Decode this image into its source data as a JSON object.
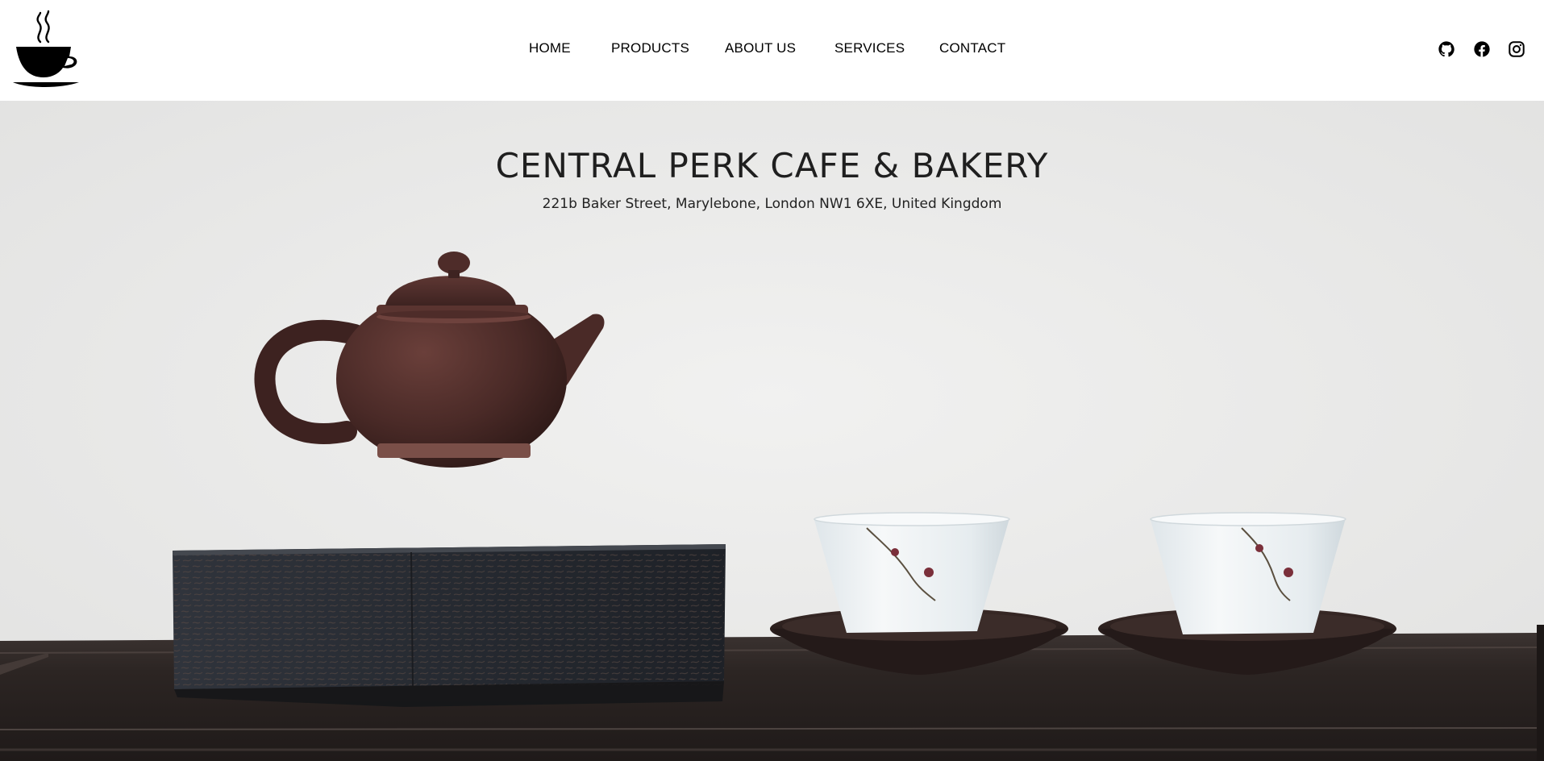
{
  "nav": {
    "links": [
      "HOME",
      "PRODUCTS",
      "ABOUT US",
      "SERVICES",
      "CONTACT"
    ]
  },
  "social": [
    "github-icon",
    "facebook-icon",
    "instagram-icon"
  ],
  "hero": {
    "title": "CENTRAL PERK CAFE & BAKERY",
    "address": "221b Baker Street, Marylebone, London NW1 6XE, United Kingdom"
  },
  "colors": {
    "nav_text": "#000000",
    "hero_bg": "#ececeb",
    "teapot": "#4a2a26",
    "stand": "#2c2f36",
    "table": "#2a2422"
  }
}
